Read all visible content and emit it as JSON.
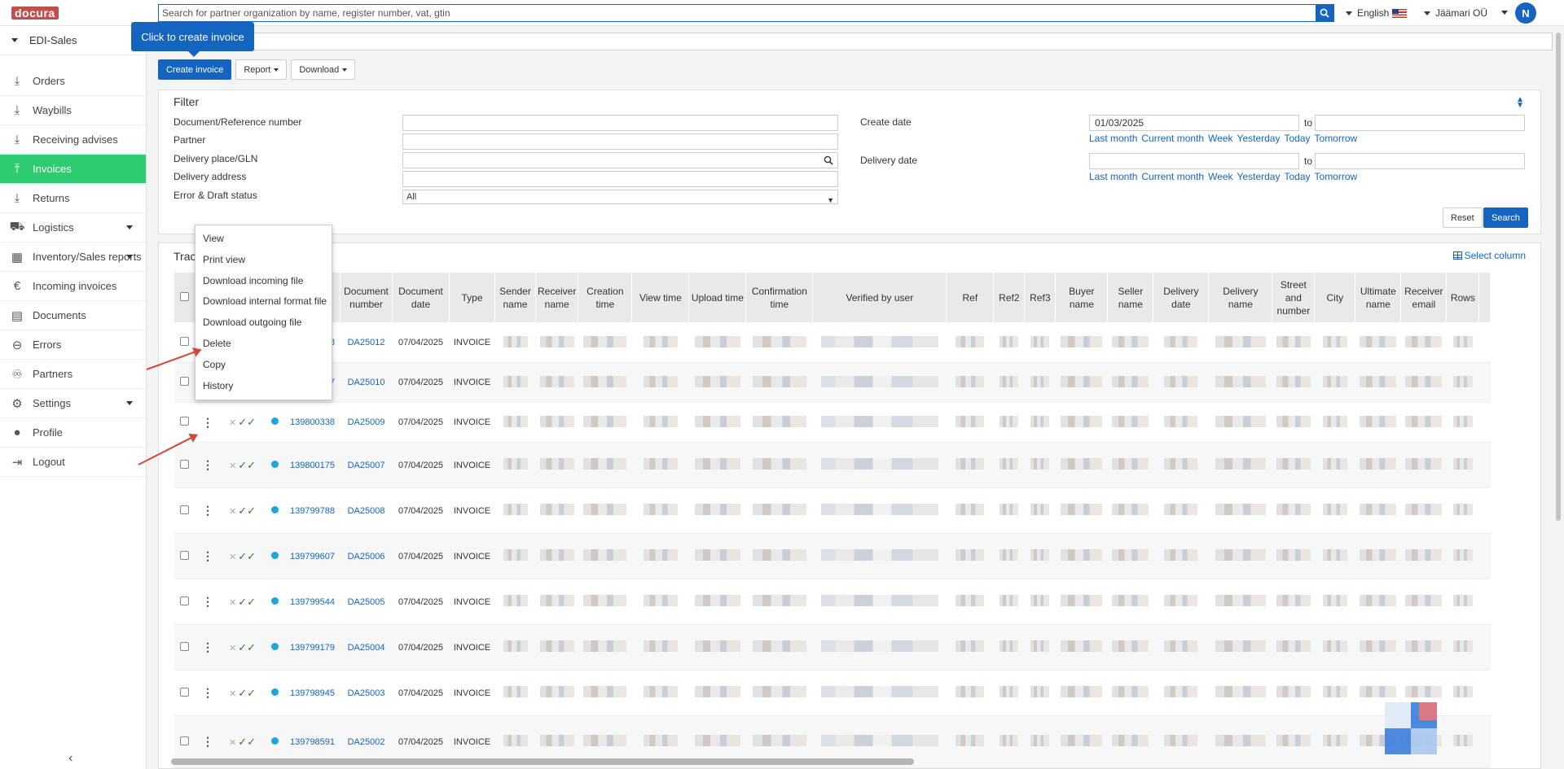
{
  "app": {
    "logo_text": "docura"
  },
  "topbar": {
    "search_placeholder": "Search for partner organization by name, register number, vat, gtin",
    "language": "English",
    "organization": "Jäämari OÜ",
    "avatar_initial": "N"
  },
  "sidebar": {
    "module": "EDI-Sales",
    "items": [
      {
        "label": "Orders",
        "icon": "download-tray-icon"
      },
      {
        "label": "Waybills",
        "icon": "download-tray-icon"
      },
      {
        "label": "Receiving advises",
        "icon": "download-tray-icon"
      },
      {
        "label": "Invoices",
        "icon": "upload-tray-icon",
        "active": true
      },
      {
        "label": "Returns",
        "icon": "download-tray-icon"
      },
      {
        "label": "Logistics",
        "icon": "truck-icon",
        "has_submenu": true
      },
      {
        "label": "Inventory/Sales reports",
        "icon": "boxes-icon",
        "has_submenu": true
      },
      {
        "label": "Incoming invoices",
        "icon": "euro-icon"
      },
      {
        "label": "Documents",
        "icon": "document-icon"
      },
      {
        "label": "Errors",
        "icon": "minus-circle-icon"
      },
      {
        "label": "Partners",
        "icon": "binoculars-icon"
      },
      {
        "label": "Settings",
        "icon": "gear-icon",
        "has_submenu": true
      },
      {
        "label": "Profile",
        "icon": "person-icon"
      },
      {
        "label": "Logout",
        "icon": "logout-icon"
      }
    ]
  },
  "tooltip": {
    "text": "Click to create invoice"
  },
  "actions": {
    "create": "Create invoice",
    "report": "Report",
    "download": "Download"
  },
  "filter": {
    "title": "Filter",
    "doc_ref_label": "Document/Reference number",
    "partner_label": "Partner",
    "delivery_place_label": "Delivery place/GLN",
    "delivery_address_label": "Delivery address",
    "error_status_label": "Error & Draft status",
    "error_status_value": "All",
    "create_date_label": "Create date",
    "create_date_from": "01/03/2025",
    "delivery_date_label": "Delivery date",
    "to_label": "to",
    "quick": [
      "Last month",
      "Current month",
      "Week",
      "Yesterday",
      "Today",
      "Tomorrow"
    ],
    "reset": "Reset",
    "search": "Search"
  },
  "table": {
    "title": "Tracking",
    "select_column": "Select column",
    "headers": [
      "Document number",
      "Document date",
      "Type",
      "Sender name",
      "Receiver name",
      "Creation time",
      "View time",
      "Upload time",
      "Confirmation time",
      "Verified by user",
      "Ref",
      "Ref2",
      "Ref3",
      "Buyer name",
      "Seller name",
      "Delivery date",
      "Delivery name",
      "Street and number",
      "City",
      "Ultimate name",
      "Receiver email",
      "Rows"
    ],
    "rows": [
      {
        "id": "139809408",
        "doc": "DA25012",
        "date": "07/04/2025",
        "type": "INVOICE"
      },
      {
        "id": "139800407",
        "doc": "DA25010",
        "date": "07/04/2025",
        "type": "INVOICE"
      },
      {
        "id": "139800338",
        "doc": "DA25009",
        "date": "07/04/2025",
        "type": "INVOICE"
      },
      {
        "id": "139800175",
        "doc": "DA25007",
        "date": "07/04/2025",
        "type": "INVOICE"
      },
      {
        "id": "139799788",
        "doc": "DA25008",
        "date": "07/04/2025",
        "type": "INVOICE"
      },
      {
        "id": "139799607",
        "doc": "DA25006",
        "date": "07/04/2025",
        "type": "INVOICE"
      },
      {
        "id": "139799544",
        "doc": "DA25005",
        "date": "07/04/2025",
        "type": "INVOICE"
      },
      {
        "id": "139799179",
        "doc": "DA25004",
        "date": "07/04/2025",
        "type": "INVOICE"
      },
      {
        "id": "139798945",
        "doc": "DA25003",
        "date": "07/04/2025",
        "type": "INVOICE"
      },
      {
        "id": "139798591",
        "doc": "DA25002",
        "date": "07/04/2025",
        "type": "INVOICE"
      }
    ]
  },
  "context_menu": {
    "items": [
      "View",
      "Print view",
      "Download incoming file",
      "Download internal format file",
      "Download outgoing file",
      "Delete",
      "Copy",
      "History"
    ]
  }
}
